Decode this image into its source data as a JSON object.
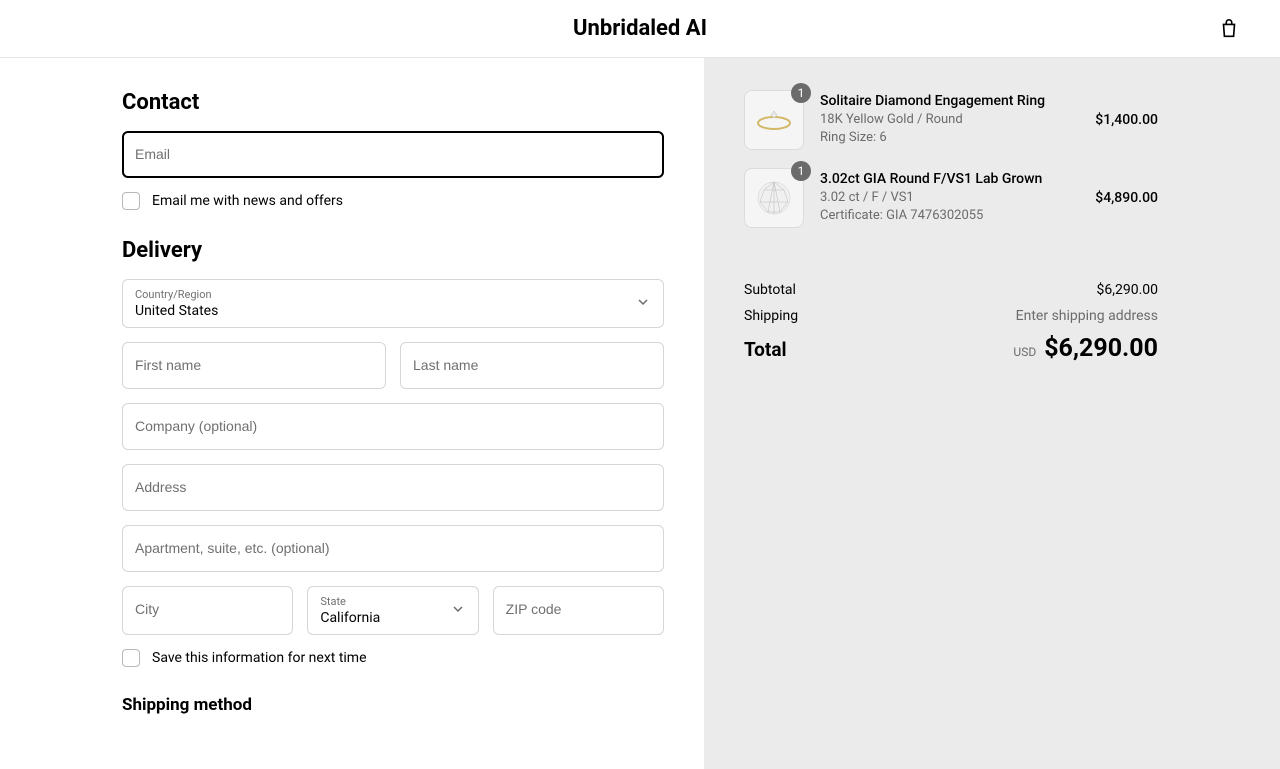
{
  "header": {
    "brand": "Unbridaled AI"
  },
  "contact": {
    "heading": "Contact",
    "email_placeholder": "Email",
    "news_label": "Email me with news and offers"
  },
  "delivery": {
    "heading": "Delivery",
    "country_label": "Country/Region",
    "country_value": "United States",
    "first_name_placeholder": "First name",
    "last_name_placeholder": "Last name",
    "company_placeholder": "Company (optional)",
    "address_placeholder": "Address",
    "apartment_placeholder": "Apartment, suite, etc. (optional)",
    "city_placeholder": "City",
    "state_label": "State",
    "state_value": "California",
    "zip_placeholder": "ZIP code",
    "save_label": "Save this information for next time",
    "shipping_method_heading": "Shipping method"
  },
  "cart": {
    "items": [
      {
        "qty": "1",
        "title": "Solitaire Diamond Engagement Ring",
        "line1": "18K Yellow Gold / Round",
        "line2": "Ring Size: 6",
        "price": "$1,400.00"
      },
      {
        "qty": "1",
        "title": "3.02ct GIA Round F/VS1 Lab Grown",
        "line1": "3.02 ct / F / VS1",
        "line2": "Certificate: GIA 7476302055",
        "price": "$4,890.00"
      }
    ],
    "subtotal_label": "Subtotal",
    "subtotal_value": "$6,290.00",
    "shipping_label": "Shipping",
    "shipping_value": "Enter shipping address",
    "total_label": "Total",
    "total_currency": "USD",
    "total_value": "$6,290.00"
  }
}
